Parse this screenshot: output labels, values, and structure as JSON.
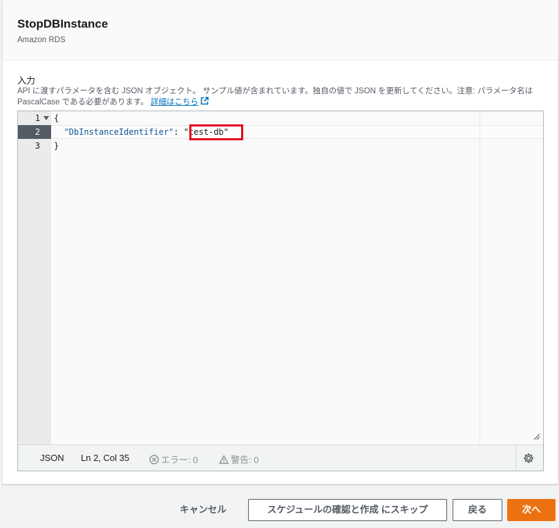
{
  "header": {
    "title": "StopDBInstance",
    "subtitle": "Amazon RDS"
  },
  "input_section": {
    "label": "入力",
    "description": "API に渡すパラメータを含む JSON オブジェクト。 サンプル値が含まれています。独自の値で JSON を更新してください。注意: パラメータ名は PascalCase である必要があります。",
    "link_text": "詳細はこちら",
    "link_icon": "external-link-icon"
  },
  "editor": {
    "lines": [
      {
        "number": "1",
        "text": "{"
      },
      {
        "number": "2",
        "key": "\"DbInstanceIdentifier\"",
        "separator": ": ",
        "value": "\"test-db\""
      },
      {
        "number": "3",
        "text": "}"
      }
    ],
    "active_line": 2,
    "status": {
      "language": "JSON",
      "position": "Ln 2, Col 35",
      "errors": "エラー: 0",
      "warnings": "警告: 0"
    },
    "highlight_color": "#e0001a"
  },
  "footer": {
    "cancel": "キャンセル",
    "skip": "スケジュールの確認と作成 にスキップ",
    "back": "戻る",
    "next": "次へ"
  },
  "colors": {
    "primary": "#ec7211",
    "link": "#0073bb",
    "gutter_active": "#545b64"
  }
}
